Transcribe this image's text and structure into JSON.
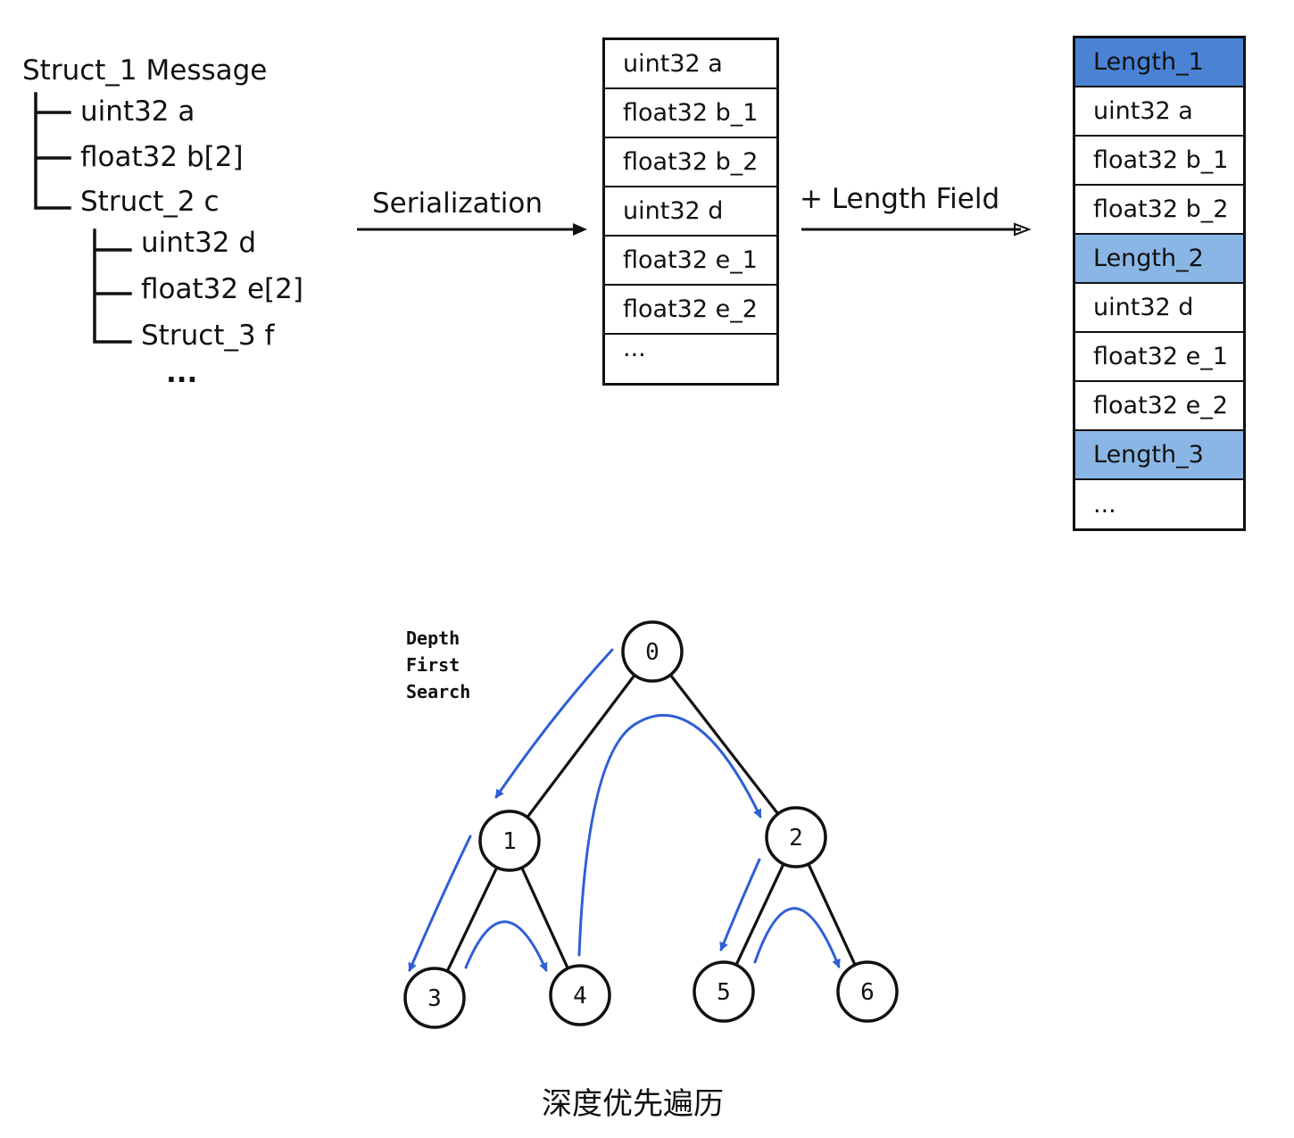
{
  "struct_tree": {
    "root": "Struct_1 Message",
    "level1": [
      "uint32 a",
      "float32 b[2]",
      "Struct_2 c"
    ],
    "level2": [
      "uint32 d",
      "float32 e[2]",
      "Struct_3 f"
    ],
    "ellipsis": "..."
  },
  "serialization": {
    "arrow_label": "Serialization",
    "cells": [
      "uint32 a",
      "float32 b_1",
      "float32 b_2",
      "uint32 d",
      "float32 e_1",
      "float32 e_2",
      "..."
    ]
  },
  "length_field": {
    "arrow_label": "+ Length Field",
    "cells": [
      {
        "label": "Length_1",
        "highlight": "dark"
      },
      {
        "label": "uint32 a",
        "highlight": "none"
      },
      {
        "label": "float32 b_1",
        "highlight": "none"
      },
      {
        "label": "float32 b_2",
        "highlight": "none"
      },
      {
        "label": "Length_2",
        "highlight": "light"
      },
      {
        "label": "uint32 d",
        "highlight": "none"
      },
      {
        "label": "float32 e_1",
        "highlight": "none"
      },
      {
        "label": "float32 e_2",
        "highlight": "none"
      },
      {
        "label": "Length_3",
        "highlight": "light"
      },
      {
        "label": "...",
        "highlight": "none"
      }
    ],
    "colors": {
      "dark": "#4a82d4",
      "light": "#8ab6e6"
    }
  },
  "dfs": {
    "label_lines": [
      "Depth",
      "First",
      "Search"
    ],
    "nodes": [
      "0",
      "1",
      "2",
      "3",
      "4",
      "5",
      "6"
    ],
    "edges": [
      [
        "0",
        "1"
      ],
      [
        "0",
        "2"
      ],
      [
        "1",
        "3"
      ],
      [
        "1",
        "4"
      ],
      [
        "2",
        "5"
      ],
      [
        "2",
        "6"
      ]
    ],
    "traversal_color": "#2f5fd6",
    "caption": "深度优先遍历"
  }
}
